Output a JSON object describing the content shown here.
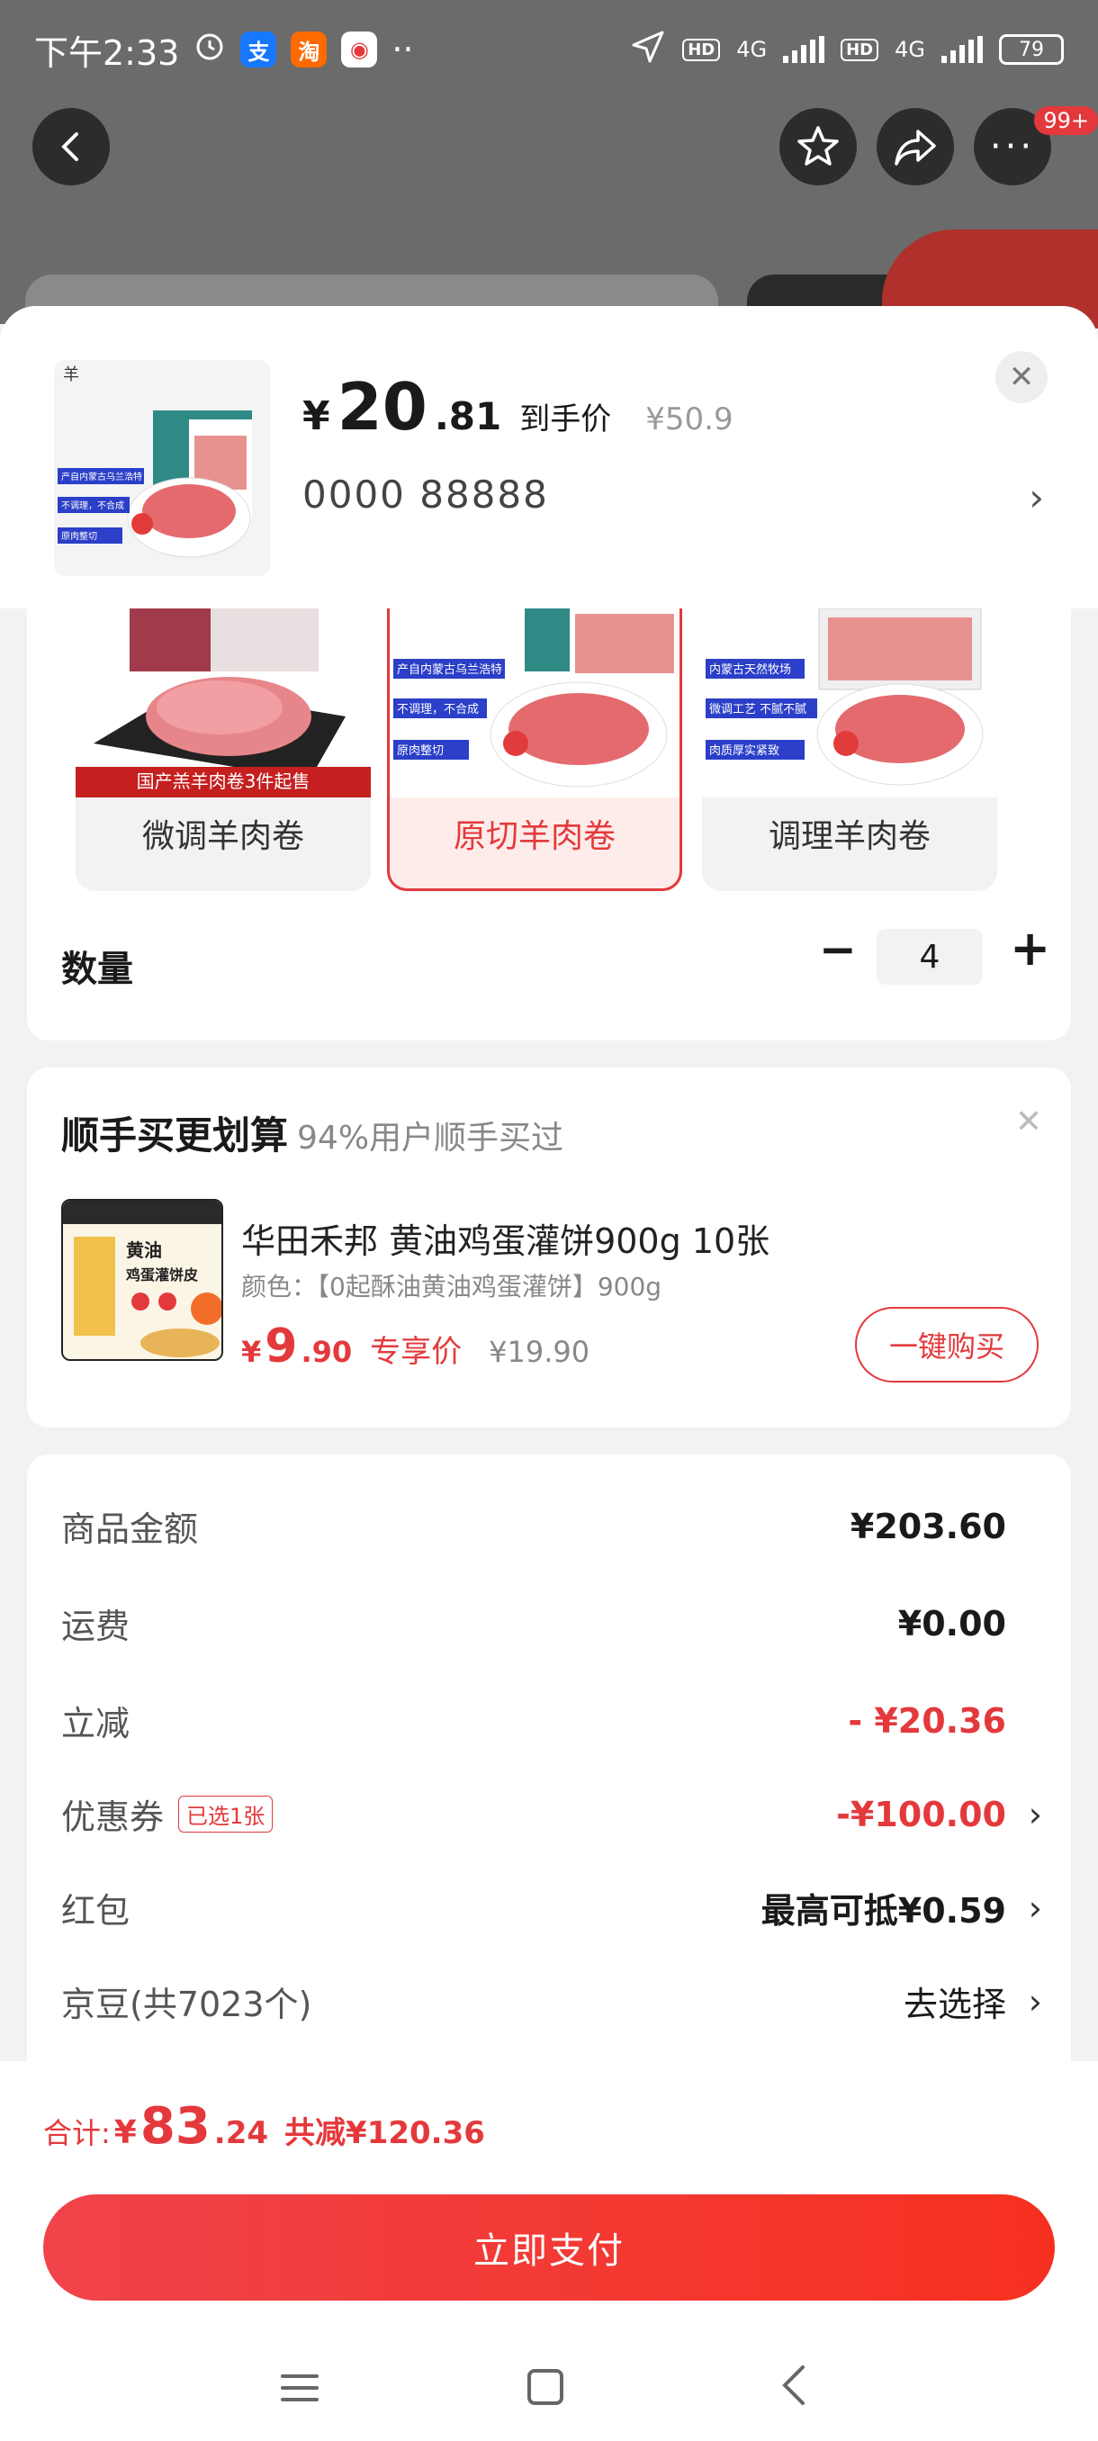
{
  "status_bar": {
    "time": "下午2:33",
    "battery": "79",
    "net1": "4G",
    "net2": "4G",
    "hd": "HD"
  },
  "header": {
    "badge": "99+"
  },
  "product": {
    "price_yen": "¥",
    "price_int": "20",
    "price_dec": ".81",
    "price_tag": "到手价",
    "original_price": "¥50.9",
    "address": "0000  88888"
  },
  "variants": [
    {
      "label": "微调羊肉卷",
      "banner": "国产羔羊肉卷3件起售",
      "selected": false
    },
    {
      "label": "原切羊肉卷",
      "selected": true
    },
    {
      "label": "调理羊肉卷",
      "selected": false
    }
  ],
  "variant_badges": {
    "v2": [
      "产自内蒙古乌兰浩特",
      "不调理，不合成",
      "原肉整切"
    ],
    "v3": [
      "内蒙古天然牧场",
      "微调工艺 不腻不腻",
      "肉质厚实紧致"
    ]
  },
  "quantity": {
    "label": "数量",
    "value": "4",
    "minus": "−",
    "plus": "+"
  },
  "addon": {
    "title": "顺手买更划算",
    "subtitle": "94%用户顺手买过",
    "product_name": "华田禾邦 黄油鸡蛋灌饼900g 10张",
    "spec": "颜色：【0起酥油黄油鸡蛋灌饼】900g",
    "price_yen": "¥",
    "price_int": "9",
    "price_dec": ".90",
    "price_tag": "专享价",
    "original_price": "¥19.90",
    "button": "一键购买",
    "image_text": "黄油\n鸡蛋灌饼皮"
  },
  "summary": [
    {
      "label": "商品金额",
      "value": "¥203.60",
      "style": "bold"
    },
    {
      "label": "运费",
      "value": "¥0.00",
      "style": "bold"
    },
    {
      "label": "立减",
      "value": "- ¥20.36",
      "style": "red"
    },
    {
      "label": "优惠券",
      "tag": "已选1张",
      "value": "-¥100.00",
      "style": "red",
      "arrow": "›"
    },
    {
      "label": "红包",
      "value": "最高可抵¥0.59",
      "style": "bold",
      "arrow": "›"
    },
    {
      "label": "京豆(共7023个)",
      "value": "去选择",
      "style": "norm",
      "arrow": "›"
    }
  ],
  "footer": {
    "total_label": "合计:",
    "total_yen": "¥",
    "total_int": "83",
    "total_dec": ".24",
    "saved": "共减¥120.36",
    "pay_button": "立即支付"
  },
  "colors": {
    "accent": "#e4393c",
    "pay_gradient_start": "#f0434a",
    "pay_gradient_end": "#f6301f"
  }
}
